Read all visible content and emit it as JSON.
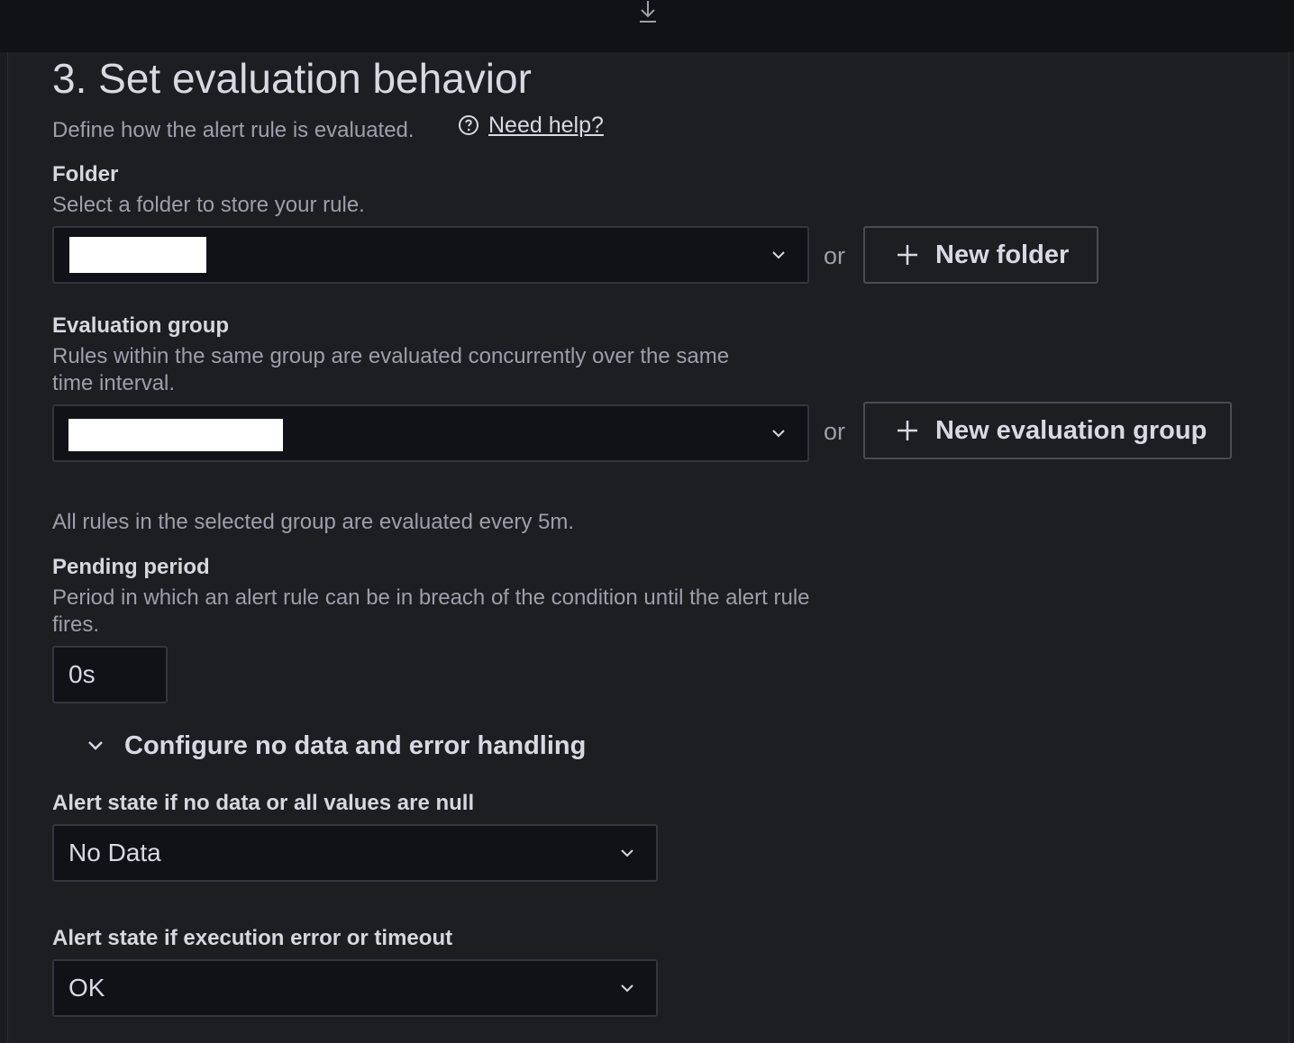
{
  "section": {
    "title": "3. Set evaluation behavior",
    "description": "Define how the alert rule is evaluated.",
    "help_link": "Need help?"
  },
  "folder": {
    "label": "Folder",
    "description": "Select a folder to store your rule.",
    "or": "or",
    "new_button": "New folder"
  },
  "group": {
    "label": "Evaluation group",
    "description_line1": "Rules within the same group are evaluated concurrently over the same",
    "description_line2": "time interval.",
    "or": "or",
    "new_button": "New evaluation group",
    "interval_note": "All rules in the selected group are evaluated every 5m."
  },
  "pending": {
    "label": "Pending period",
    "description_line1": "Period in which an alert rule can be in breach of the condition until the alert rule",
    "description_line2": "fires.",
    "value": "0s"
  },
  "error_handling": {
    "toggle_label": "Configure no data and error handling",
    "no_data_label": "Alert state if no data or all values are null",
    "no_data_value": "No Data",
    "exec_error_label": "Alert state if execution error or timeout",
    "exec_error_value": "OK"
  },
  "icons": {
    "download": "download-icon",
    "help": "help-circle-icon",
    "chevron": "chevron-down-icon",
    "plus": "plus-icon"
  }
}
